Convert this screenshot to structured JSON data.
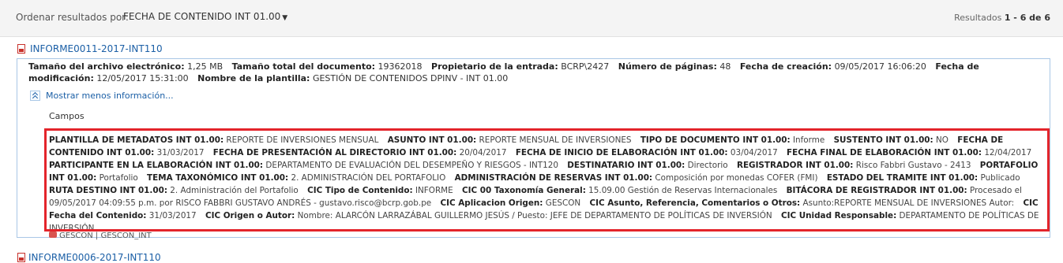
{
  "toolbar": {
    "sort_label": "Ordenar resultados por:",
    "sort_value": "FECHA DE CONTENIDO INT 01.00",
    "results_prefix": "Resultados",
    "results_range": "1 - 6 de 6"
  },
  "result": {
    "title": "INFORME0011-2017-INT110",
    "metadata": [
      {
        "label": "Tamaño del archivo electrónico:",
        "value": "1,25 MB"
      },
      {
        "label": "Tamaño total del documento:",
        "value": "19362018"
      },
      {
        "label": "Propietario de la entrada:",
        "value": "BCRP\\2427"
      },
      {
        "label": "Número de páginas:",
        "value": "48"
      },
      {
        "label": "Fecha de creación:",
        "value": "09/05/2017 16:06:20"
      },
      {
        "label": "Fecha de modificación:",
        "value": "12/05/2017 15:31:00"
      },
      {
        "label": "Nombre de la plantilla:",
        "value": "GESTIÓN DE CONTENIDOS DPINV - INT 01.00"
      }
    ],
    "toggle_label": "Mostrar menos información...",
    "campos_label": "Campos",
    "fields": [
      {
        "label": "PLANTILLA DE METADATOS INT 01.00:",
        "value": "REPORTE DE INVERSIONES MENSUAL"
      },
      {
        "label": "ASUNTO INT 01.00:",
        "value": "REPORTE MENSUAL DE INVERSIONES"
      },
      {
        "label": "TIPO DE DOCUMENTO INT 01.00:",
        "value": "Informe"
      },
      {
        "label": "SUSTENTO INT 01.00:",
        "value": "NO"
      },
      {
        "label": "FECHA DE CONTENIDO INT 01.00:",
        "value": "31/03/2017"
      },
      {
        "label": "FECHA DE PRESENTACIÓN AL DIRECTORIO INT 01.00:",
        "value": "20/04/2017"
      },
      {
        "label": "FECHA DE INICIO DE ELABORACIÓN INT 01.00:",
        "value": "03/04/2017"
      },
      {
        "label": "FECHA FINAL DE ELABORACIÓN INT 01.00:",
        "value": "12/04/2017"
      },
      {
        "label": "PARTICIPANTE EN LA ELABORACIÓN INT 01.00:",
        "value": "DEPARTAMENTO DE EVALUACIÓN DEL DESEMPEÑO Y RIESGOS - INT120"
      },
      {
        "label": "DESTINATARIO INT 01.00:",
        "value": "Directorio"
      },
      {
        "label": "REGISTRADOR INT 01.00:",
        "value": "Risco Fabbri Gustavo - 2413"
      },
      {
        "label": "PORTAFOLIO INT 01.00:",
        "value": "Portafolio"
      },
      {
        "label": "TEMA TAXONÓMICO INT 01.00:",
        "value": "2. ADMINISTRACIÓN DEL PORTAFOLIO"
      },
      {
        "label": "ADMINISTRACIÓN DE RESERVAS INT 01.00:",
        "value": "Composición por monedas COFER (FMI)"
      },
      {
        "label": "ESTADO DEL TRAMITE INT 01.00:",
        "value": "Publicado"
      },
      {
        "label": "RUTA DESTINO INT 01.00:",
        "value": "2. Administración del Portafolio"
      },
      {
        "label": "CIC Tipo de Contenido:",
        "value": "INFORME"
      },
      {
        "label": "CIC 00 Taxonomía General:",
        "value": "15.09.00 Gestión de Reservas Internacionales"
      },
      {
        "label": "BITÁCORA DE REGISTRADOR INT 01.00:",
        "value": "Procesado el 09/05/2017 04:09:55 p.m. por RISCO FABBRI GUSTAVO ANDRÉS - gustavo.risco@bcrp.gob.pe"
      },
      {
        "label": "CIC Aplicacion Origen:",
        "value": "GESCON"
      },
      {
        "label": "CIC Asunto, Referencia, Comentarios o Otros:",
        "value": "Asunto:REPORTE MENSUAL DE INVERSIONES Autor:"
      },
      {
        "label": "CIC Fecha del Contenido:",
        "value": "31/03/2017"
      },
      {
        "label": "CIC Origen o Autor:",
        "value": "Nombre: ALARCÓN LARRAZÁBAL GUILLERMO JESÚS / Puesto: JEFE DE DEPARTAMENTO DE POLÍTICAS DE INVERSIÓN"
      },
      {
        "label": "CIC Unidad Responsable:",
        "value": "DEPARTAMENTO DE POLÍTICAS DE INVERSIÓN"
      }
    ],
    "tags": "GESCON | GESCON_INT"
  },
  "next_result": {
    "title": "INFORME0006-2017-INT110"
  }
}
